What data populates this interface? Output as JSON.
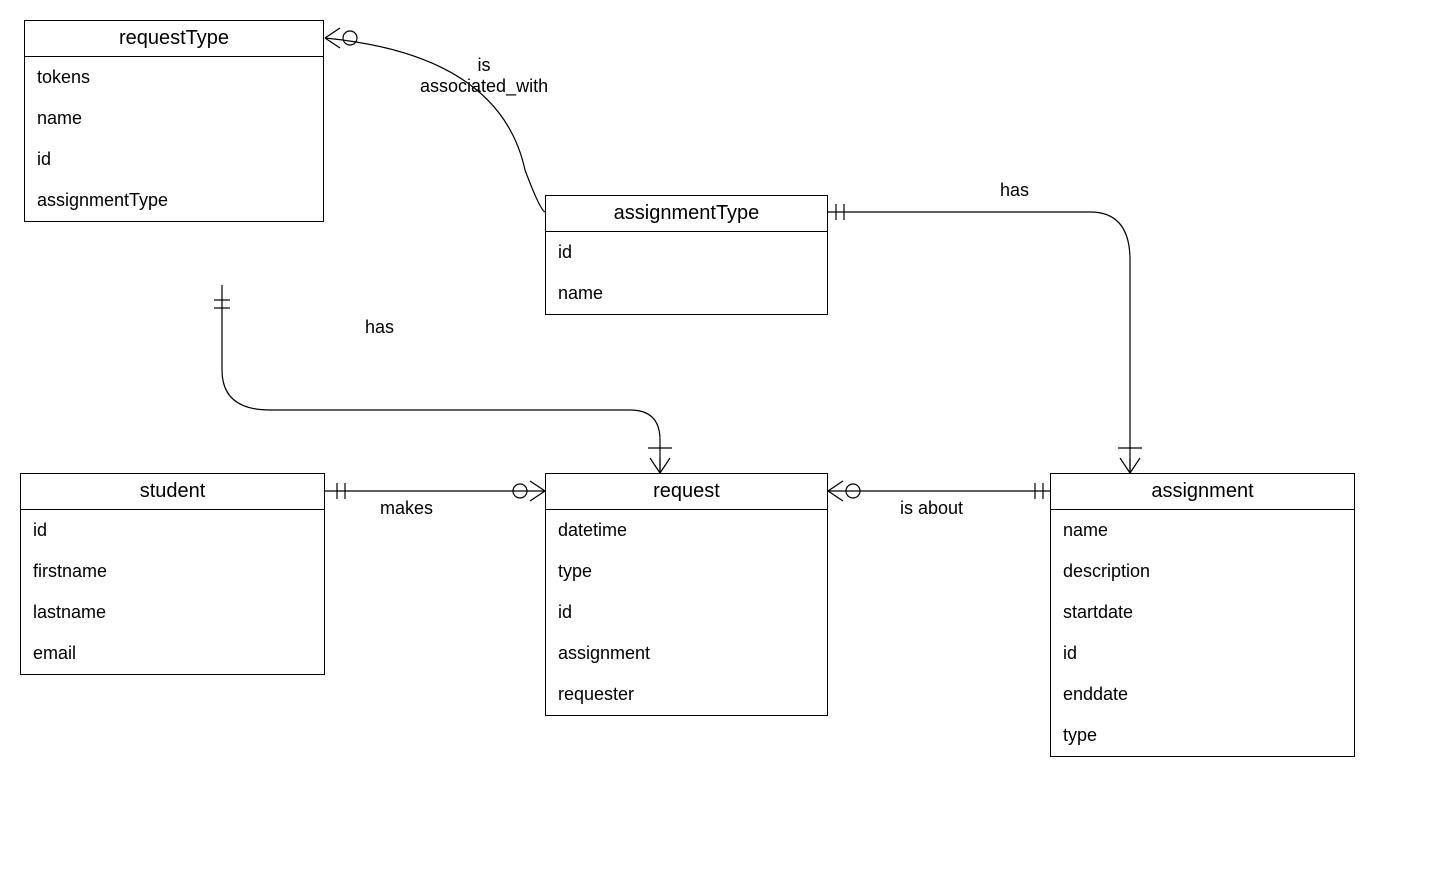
{
  "entities": {
    "requestType": {
      "title": "requestType",
      "attrs": [
        "tokens",
        "name",
        "id",
        "assignmentType"
      ]
    },
    "assignmentType": {
      "title": "assignmentType",
      "attrs": [
        "id",
        "name"
      ]
    },
    "student": {
      "title": "student",
      "attrs": [
        "id",
        "firstname",
        "lastname",
        "email"
      ]
    },
    "request": {
      "title": "request",
      "attrs": [
        "datetime",
        "type",
        "id",
        "assignment",
        "requester"
      ]
    },
    "assignment": {
      "title": "assignment",
      "attrs": [
        "name",
        "description",
        "startdate",
        "id",
        "enddate",
        "type"
      ]
    }
  },
  "relationships": {
    "is_associated_with": "is\nassociated_with",
    "has_1": "has",
    "has_2": "has",
    "makes": "makes",
    "is_about": "is about"
  }
}
